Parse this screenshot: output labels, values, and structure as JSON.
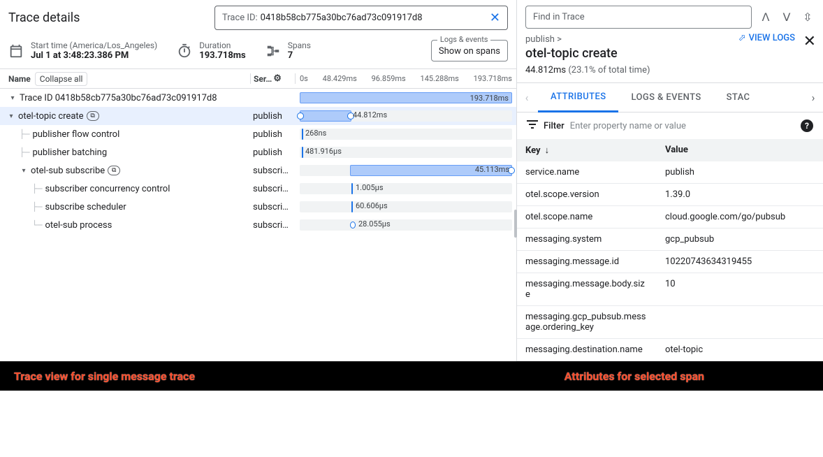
{
  "header": {
    "title": "Trace details",
    "trace_id_label": "Trace ID:",
    "trace_id": "0418b58cb775a30bc76ad73c091917d8"
  },
  "meta": {
    "start_label": "Start time (America/Los_Angeles)",
    "start_value": "Jul 1 at 3:48:23.386 PM",
    "duration_label": "Duration",
    "duration_value": "193.718ms",
    "spans_label": "Spans",
    "spans_value": "7",
    "logs_legend": "Logs & events",
    "logs_value": "Show on spans"
  },
  "cols": {
    "name": "Name",
    "collapse": "Collapse all",
    "service": "Ser…",
    "ticks": [
      "0s",
      "48.429ms",
      "96.859ms",
      "145.288ms",
      "193.718ms"
    ]
  },
  "rows": [
    {
      "name": "Trace ID 0418b58cb775a30bc76ad73c091917d8",
      "service": "",
      "label": "193.718ms"
    },
    {
      "name": "otel-topic create",
      "service": "publish",
      "label": "44.812ms"
    },
    {
      "name": "publisher flow control",
      "service": "publish",
      "label": "268ns"
    },
    {
      "name": "publisher batching",
      "service": "publish",
      "label": "481.916µs"
    },
    {
      "name": "otel-sub subscribe",
      "service": "subscri…",
      "label": "45.113ms"
    },
    {
      "name": "subscriber concurrency control",
      "service": "subscri…",
      "label": "1.005µs"
    },
    {
      "name": "subscribe scheduler",
      "service": "subscri…",
      "label": "60.606µs"
    },
    {
      "name": "otel-sub process",
      "service": "subscri…",
      "label": "28.055µs"
    }
  ],
  "rp": {
    "find_ph": "Find in Trace",
    "crumb": "publish >",
    "title": "otel-topic create",
    "dur": "44.812ms",
    "pct": "(23.1% of total time)",
    "view_logs": "VIEW LOGS",
    "tabs": {
      "attributes": "ATTRIBUTES",
      "logs": "LOGS & EVENTS",
      "stack": "STAC"
    },
    "filter_label": "Filter",
    "filter_ph": "Enter property name or value",
    "col_key": "Key",
    "col_val": "Value",
    "attrs": [
      {
        "k": "service.name",
        "v": "publish"
      },
      {
        "k": "otel.scope.version",
        "v": "1.39.0"
      },
      {
        "k": "otel.scope.name",
        "v": "cloud.google.com/go/pubsub"
      },
      {
        "k": "messaging.system",
        "v": "gcp_pubsub"
      },
      {
        "k": "messaging.message.id",
        "v": "10220743634319455"
      },
      {
        "k": "messaging.message.body.size",
        "v": "10"
      },
      {
        "k": "messaging.gcp_pubsub.message.ordering_key",
        "v": ""
      },
      {
        "k": "messaging.destination.name",
        "v": "otel-topic"
      }
    ]
  },
  "captions": {
    "left": "Trace view for single message trace",
    "right": "Attributes for selected span"
  }
}
